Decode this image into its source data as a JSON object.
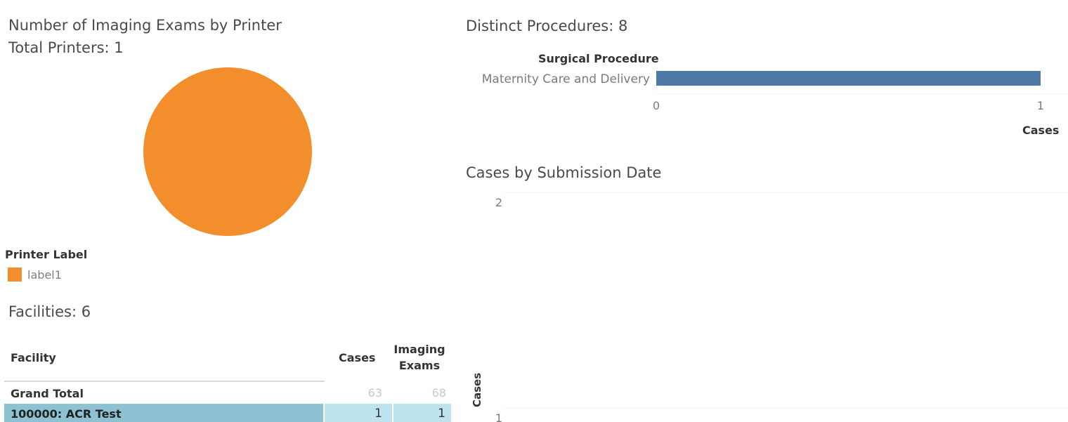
{
  "pie": {
    "title": "Number of Imaging Exams by Printer",
    "subtitle": "Total Printers: 1",
    "legend_title": "Printer Label",
    "legend_items": [
      {
        "label": "label1",
        "color": "#f28e2b"
      }
    ]
  },
  "facilities": {
    "title": "Facilities: 6",
    "headers": {
      "facility": "Facility",
      "cases": "Cases",
      "exams_line1": "Imaging",
      "exams_line2": "Exams"
    },
    "grand_total": {
      "label": "Grand Total",
      "cases": "63",
      "exams": "68"
    },
    "rows": [
      {
        "facility": "100000: ACR Test",
        "cases": "1",
        "exams": "1"
      }
    ]
  },
  "procedures": {
    "title": "Distinct Procedures: 8",
    "col_header": "Surgical Procedure",
    "x_label": "Cases"
  },
  "timeline": {
    "title": "Cases by Submission Date",
    "y_label": "Cases"
  },
  "chart_data": [
    {
      "type": "pie",
      "title": "Number of Imaging Exams by Printer",
      "categories": [
        "label1"
      ],
      "values": [
        1
      ],
      "colors": [
        "#f28e2b"
      ]
    },
    {
      "type": "bar",
      "orientation": "horizontal",
      "title": "Distinct Procedures: 8",
      "categories": [
        "Maternity Care and Delivery"
      ],
      "values": [
        1
      ],
      "xlabel": "Cases",
      "xlim": [
        0,
        1
      ],
      "xticks": [
        0,
        1
      ],
      "color": "#4e79a7"
    },
    {
      "type": "line",
      "title": "Cases by Submission Date",
      "ylabel": "Cases",
      "yticks": [
        1,
        2
      ]
    }
  ]
}
